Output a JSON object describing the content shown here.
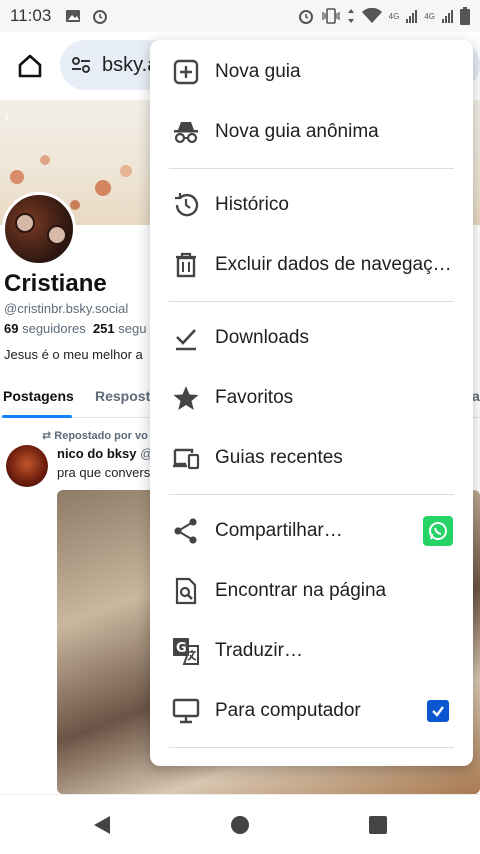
{
  "status_bar": {
    "time": "11:03",
    "net_label_1": "4G",
    "net_label_2": "4G"
  },
  "browser": {
    "url": "bsky.a"
  },
  "profile": {
    "name": "Cristiane",
    "handle": "@cristinbr.bsky.social",
    "followers_count": "69",
    "followers_label": "seguidores",
    "following_count": "251",
    "following_label": "segu",
    "bio": "Jesus é o meu melhor a",
    "tabs": [
      "Postagens",
      "Respost",
      "a"
    ]
  },
  "post": {
    "repost_label": "Repostado por vo",
    "author": "nico do bksy",
    "author_handle": "@",
    "text": "pra que convers"
  },
  "menu": {
    "items": [
      {
        "label": "Nova guia",
        "icon": "new-tab-icon"
      },
      {
        "label": "Nova guia anônima",
        "icon": "incognito-icon"
      },
      {
        "label": "Histórico",
        "icon": "history-icon"
      },
      {
        "label": "Excluir dados de navegaç…",
        "icon": "trash-icon"
      },
      {
        "label": "Downloads",
        "icon": "download-icon"
      },
      {
        "label": "Favoritos",
        "icon": "star-icon"
      },
      {
        "label": "Guias recentes",
        "icon": "devices-icon"
      },
      {
        "label": "Compartilhar…",
        "icon": "share-icon"
      },
      {
        "label": "Encontrar na página",
        "icon": "find-in-page-icon"
      },
      {
        "label": "Traduzir…",
        "icon": "translate-icon"
      },
      {
        "label": "Para computador",
        "icon": "desktop-icon"
      }
    ],
    "desktop_site_checked": true
  },
  "colors": {
    "accent": "#0b57d0",
    "whatsapp": "#25d366",
    "link_blue": "#1083fe"
  }
}
